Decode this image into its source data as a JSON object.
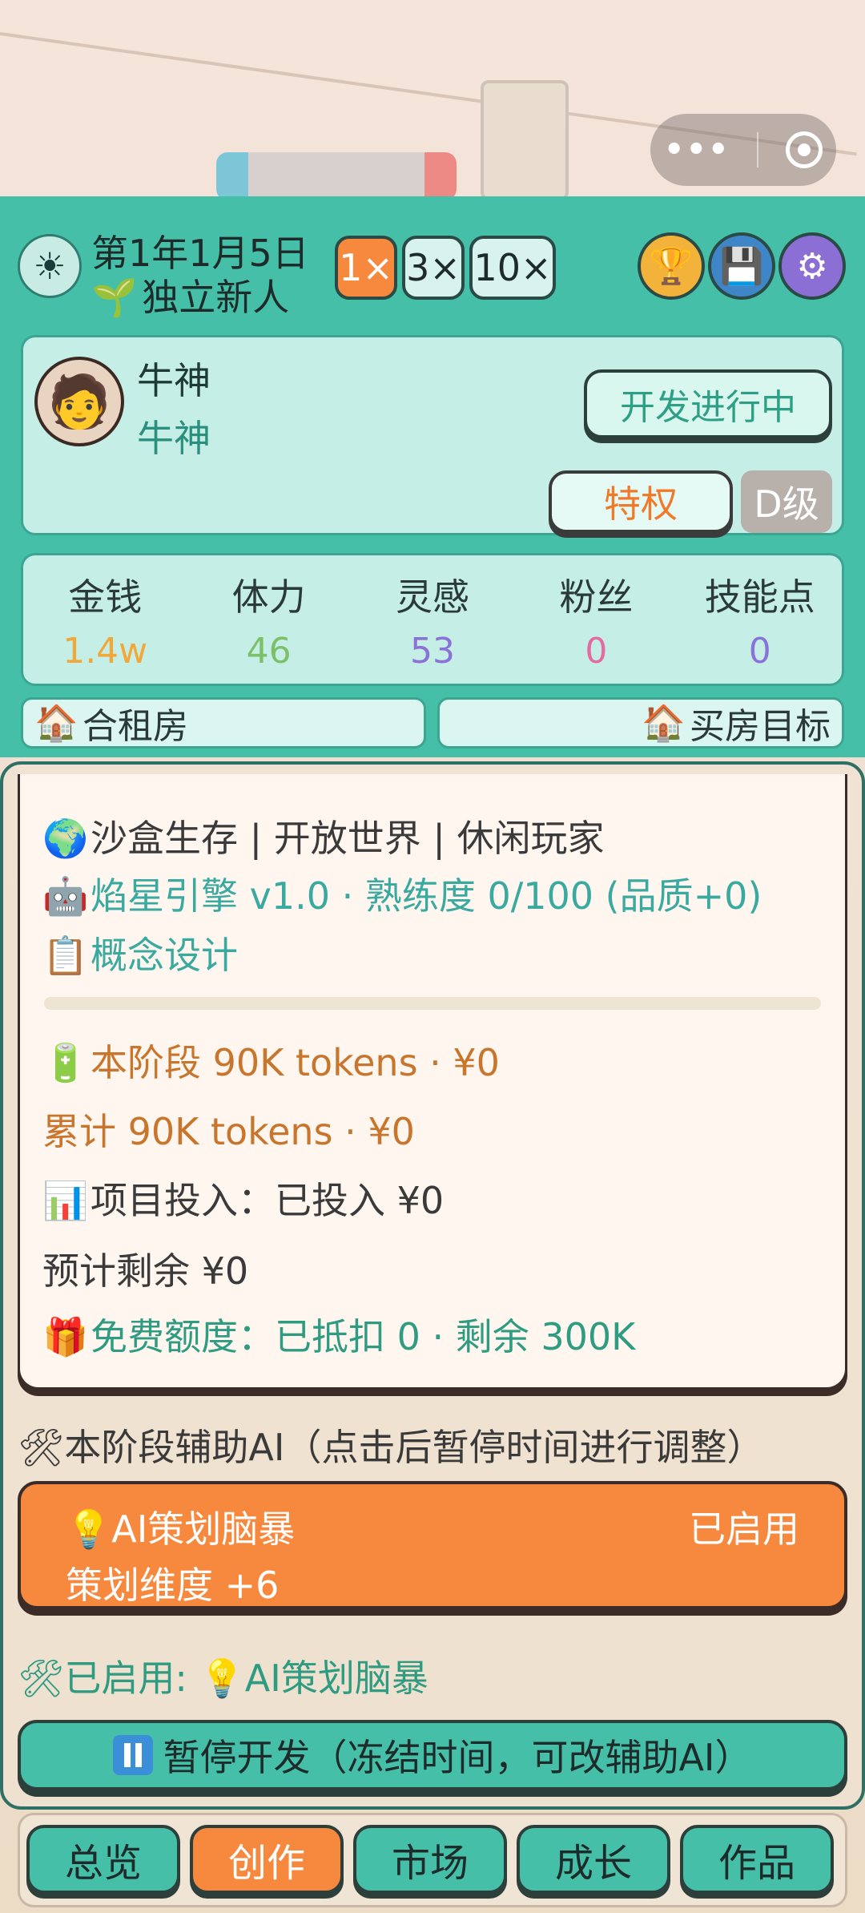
{
  "capsule": {
    "more": "•••"
  },
  "header": {
    "date": "第1年1月5日",
    "rank": "独立新人",
    "speeds": [
      "1×",
      "3×",
      "10×"
    ],
    "active_speed": "1×"
  },
  "profile": {
    "name": "牛神",
    "studio": "牛神",
    "status_button": "开发进行中",
    "privilege_button": "特权",
    "grade": "D级"
  },
  "stats": [
    {
      "label": "金钱",
      "value": "1.4w",
      "color": "#f0a83a"
    },
    {
      "label": "体力",
      "value": "46",
      "color": "#7cc06a"
    },
    {
      "label": "灵感",
      "value": "53",
      "color": "#8a72d6"
    },
    {
      "label": "粉丝",
      "value": "0",
      "color": "#e56aa0"
    },
    {
      "label": "技能点",
      "value": "0",
      "color": "#8a72d6"
    }
  ],
  "housing": {
    "current": "合租房",
    "goal": "买房目标"
  },
  "project": {
    "genre_line": "沙盒生存 | 开放世界 | 休闲玩家",
    "engine_line": "焰星引擎 v1.0 · 熟练度 0/100 (品质+0)",
    "phase": "概念设计",
    "phase_progress": 0,
    "tokens_stage": "本阶段 90K tokens · ¥0",
    "tokens_total": "累计 90K tokens · ¥0",
    "investment": "项目投入：已投入 ¥0",
    "remaining": "预计剩余 ¥0",
    "free_quota": "免费额度：已抵扣 0 · 剩余 300K"
  },
  "ai": {
    "section_title": "本阶段辅助AI（点击后暂停时间进行调整）",
    "card_name": "💡AI策划脑暴",
    "card_status": "已启用",
    "card_effect": "策划维度 +6",
    "enabled_line": "已启用: 💡AI策划脑暴",
    "pause_button": "暂停开发（冻结时间，可改辅助AI）"
  },
  "nav": {
    "tabs": [
      "总览",
      "创作",
      "市场",
      "成长",
      "作品"
    ],
    "active": "创作"
  },
  "colors": {
    "teal": "#46bfa8",
    "orange": "#f6893e",
    "card_bg": "#fff7ef"
  }
}
